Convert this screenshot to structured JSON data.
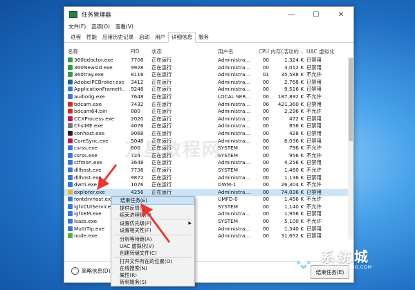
{
  "window": {
    "title": "任务管理器",
    "controls": {
      "minimize": "—",
      "maximize": "☐",
      "close": "✕"
    }
  },
  "menubar": [
    "文件(F)",
    "选项(O)",
    "查看(V)"
  ],
  "tabs": [
    "进程",
    "性能",
    "应用历史记录",
    "启动",
    "用户",
    "详细信息",
    "服务"
  ],
  "active_tab": "详细信息",
  "columns": {
    "name": "名称",
    "pid": "PID",
    "status": "状态",
    "user": "用户名",
    "cpu": "CPU",
    "mem": "内存(活动的...",
    "uac": "UAC 虚拟化"
  },
  "rows": [
    {
      "name": "360bdoctor.exe",
      "pid": "7708",
      "status": "正在运行",
      "user": "Administra...",
      "cpu": "00",
      "mem": "1,324 K",
      "uac": "已禁用",
      "icon_color": "#2e9e48"
    },
    {
      "name": "360Newsld.exe",
      "pid": "9928",
      "status": "正在运行",
      "user": "Administra...",
      "cpu": "00",
      "mem": "3,012 K",
      "uac": "已禁用",
      "icon_color": "#2e9e48"
    },
    {
      "name": "360tray.exe",
      "pid": "8116",
      "status": "正在运行",
      "user": "Administra...",
      "cpu": "01",
      "mem": "35,588 K",
      "uac": "不允许",
      "icon_color": "#2e9e48"
    },
    {
      "name": "AdobeIPCBroker.exe",
      "pid": "3412",
      "status": "正在运行",
      "user": "Administra...",
      "cpu": "00",
      "mem": "2,768 K",
      "uac": "已禁用",
      "icon_color": "#1e5fa8"
    },
    {
      "name": "ApplicationFrameH...",
      "pid": "9248",
      "status": "正在运行",
      "user": "Administra...",
      "cpu": "00",
      "mem": "9,516 K",
      "uac": "已禁用",
      "icon_color": "#3b78d8"
    },
    {
      "name": "audiodg.exe",
      "pid": "7648",
      "status": "正在运行",
      "user": "LOCAL SER...",
      "cpu": "00",
      "mem": "187,892 K",
      "uac": "不允许",
      "icon_color": "#3b78d8"
    },
    {
      "name": "bdcam.exe",
      "pid": "7432",
      "status": "正在运行",
      "user": "Administra...",
      "cpu": "06",
      "mem": "421,360 K",
      "uac": "已禁用",
      "icon_color": "#d42a2a"
    },
    {
      "name": "bdcam64.bin",
      "pid": "880",
      "status": "正在运行",
      "user": "Administra...",
      "cpu": "00",
      "mem": "2,296 K",
      "uac": "不允许",
      "icon_color": "#d42a2a"
    },
    {
      "name": "CCXProcess.exe",
      "pid": "2020",
      "status": "正在运行",
      "user": "Administra...",
      "cpu": "00",
      "mem": "472 K",
      "uac": "已禁用",
      "icon_color": "#c2185b"
    },
    {
      "name": "ChsIME.exe",
      "pid": "4076",
      "status": "正在运行",
      "user": "Administra...",
      "cpu": "00",
      "mem": "856 K",
      "uac": "已禁用",
      "icon_color": "#7a7a7a"
    },
    {
      "name": "conhost.exe",
      "pid": "9068",
      "status": "正在运行",
      "user": "Administra...",
      "cpu": "00",
      "mem": "428 K",
      "uac": "已禁用",
      "icon_color": "#222222"
    },
    {
      "name": "CoreSync.exe",
      "pid": "5048",
      "status": "正在运行",
      "user": "Administra...",
      "cpu": "00",
      "mem": "6,036 K",
      "uac": "已禁用",
      "icon_color": "#c2185b"
    },
    {
      "name": "csrss.exe",
      "pid": "600",
      "status": "正在运行",
      "user": "SYSTEM",
      "cpu": "00",
      "mem": "796 K",
      "uac": "不允许",
      "icon_color": "#3b78d8"
    },
    {
      "name": "csrss.exe",
      "pid": "724",
      "status": "正在运行",
      "user": "SYSTEM",
      "cpu": "00",
      "mem": "956 K",
      "uac": "不允许",
      "icon_color": "#3b78d8"
    },
    {
      "name": "ctfmon.exe",
      "pid": "3648",
      "status": "正在运行",
      "user": "Administra...",
      "cpu": "00",
      "mem": "4,256 K",
      "uac": "已禁用",
      "icon_color": "#3b78d8"
    },
    {
      "name": "dllhost.exe",
      "pid": "7736",
      "status": "正在运行",
      "user": "SYSTEM",
      "cpu": "00",
      "mem": "1,460 K",
      "uac": "不允许",
      "icon_color": "#3b78d8"
    },
    {
      "name": "dllhost.exe",
      "pid": "9872",
      "status": "正在运行",
      "user": "Administra...",
      "cpu": "00",
      "mem": "1,136 K",
      "uac": "已禁用",
      "icon_color": "#3b78d8"
    },
    {
      "name": "dwm.exe",
      "pid": "1076",
      "status": "正在运行",
      "user": "DWM-1",
      "cpu": "00",
      "mem": "26,304 K",
      "uac": "不允许",
      "icon_color": "#3b78d8"
    },
    {
      "name": "explorer.exe",
      "pid": "4256",
      "status": "正在运行",
      "user": "Administra...",
      "cpu": "00",
      "mem": "74,036 K",
      "uac": "已禁用",
      "icon_color": "#e3b341",
      "selected": true
    },
    {
      "name": "fontdrvhost.exe",
      "pid": "",
      "status": "",
      "user": "UMFD-0",
      "cpu": "00",
      "mem": "1,456 K",
      "uac": "不允许",
      "icon_color": "#3b78d8"
    },
    {
      "name": "igfxCUIService...",
      "pid": "",
      "status": "",
      "user": "SYSTEM",
      "cpu": "00",
      "mem": "1,140 K",
      "uac": "不允许",
      "icon_color": "#3b78d8"
    },
    {
      "name": "igfxEM.exe",
      "pid": "",
      "status": "",
      "user": "Administra...",
      "cpu": "00",
      "mem": "1,956 K",
      "uac": "已禁用",
      "icon_color": "#3b78d8"
    },
    {
      "name": "lsass.exe",
      "pid": "",
      "status": "",
      "user": "SYSTEM",
      "cpu": "00",
      "mem": "5,100 K",
      "uac": "不允许",
      "icon_color": "#3b78d8"
    },
    {
      "name": "MultiTip.exe",
      "pid": "",
      "status": "",
      "user": "Administra...",
      "cpu": "00",
      "mem": "1,340 K",
      "uac": "已禁用",
      "icon_color": "#3b78d8"
    },
    {
      "name": "node.exe",
      "pid": "",
      "status": "",
      "user": "Administra...",
      "cpu": "00",
      "mem": "31,652 K",
      "uac": "已禁用",
      "icon_color": "#4caf50"
    }
  ],
  "context_menu": {
    "items": [
      {
        "label": "结束任务(E)",
        "highlight": true
      },
      {
        "label": "提供反馈(B)"
      },
      {
        "label": "结束进程树(T)"
      },
      {
        "sep": true
      },
      {
        "label": "设置优先级(P)",
        "submenu": true
      },
      {
        "label": "设置相关性(F)"
      },
      {
        "sep": true
      },
      {
        "label": "分析等待链(A)"
      },
      {
        "label": "UAC 虚拟化(V)"
      },
      {
        "label": "创建转储文件(C)"
      },
      {
        "sep": true
      },
      {
        "label": "打开文件所在的位置(O)"
      },
      {
        "label": "在线搜索(N)"
      },
      {
        "label": "属性(R)"
      },
      {
        "label": "转到服务(S)"
      }
    ]
  },
  "footer": {
    "brief_label": "简略信息(D)",
    "end_task_button": "结束任务(E)"
  },
  "branding": {
    "watermark_text": "万星教程网",
    "logo_main": "系统城",
    "logo_sub": "XITONGCHENG.COM",
    "annotation_color": "#e53935"
  }
}
